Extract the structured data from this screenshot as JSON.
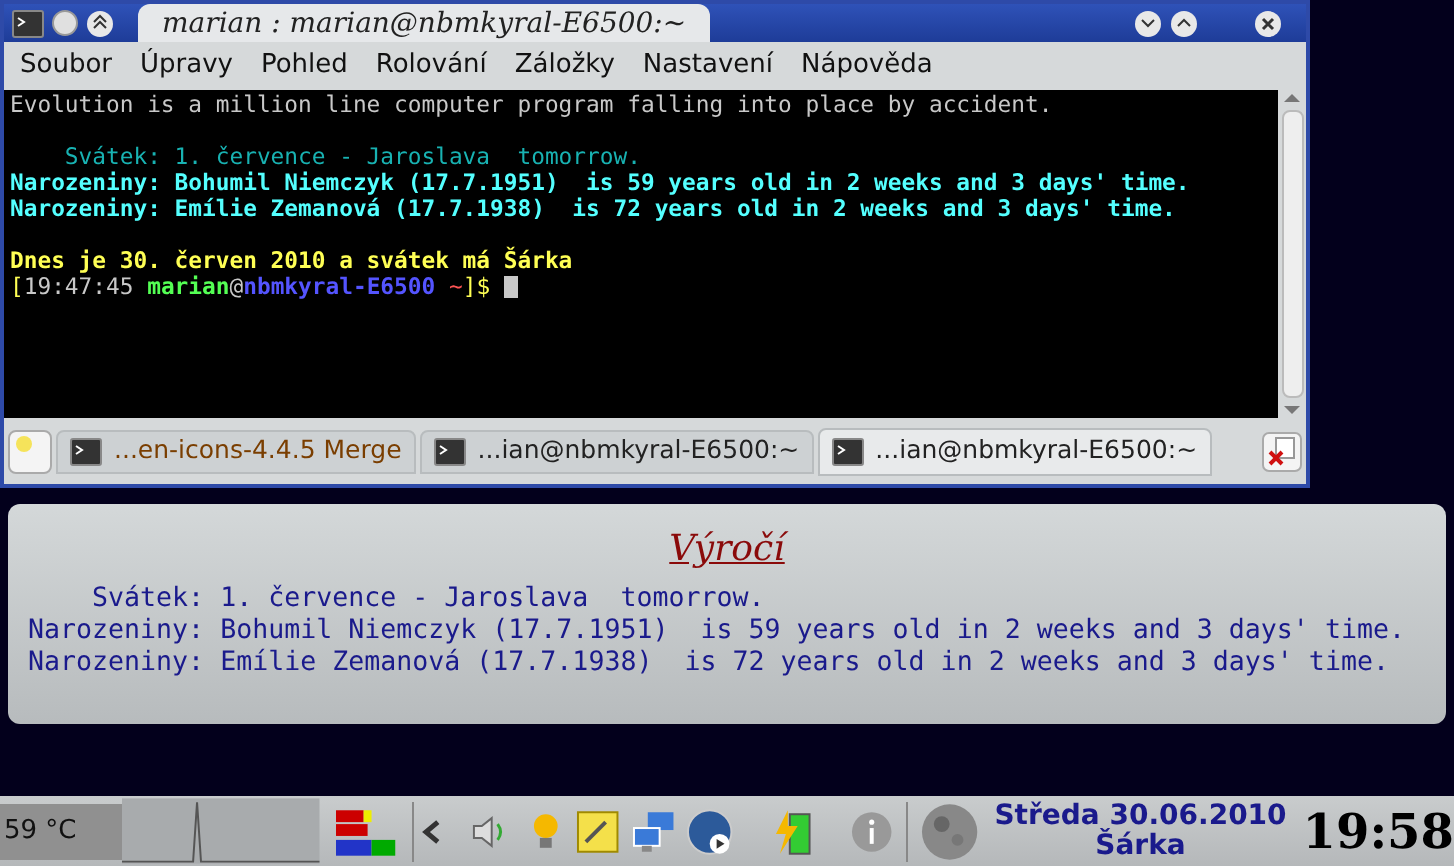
{
  "window": {
    "title": "marian : marian@nbmkyral-E6500:~"
  },
  "menu": [
    "Soubor",
    "Úpravy",
    "Pohled",
    "Rolování",
    "Záložky",
    "Nastavení",
    "Nápověda"
  ],
  "terminal": {
    "lines": [
      {
        "kind": "text",
        "segments": [
          {
            "text": "Evolution is a million line computer program falling into place by accident.",
            "color": "#c8c8c8",
            "bold": false
          }
        ]
      },
      {
        "kind": "blank"
      },
      {
        "kind": "text",
        "segments": [
          {
            "text": "    Svátek: 1. července - Jaroslava  tomorrow.",
            "color": "#18b2b2",
            "bold": false
          }
        ]
      },
      {
        "kind": "text",
        "segments": [
          {
            "text": "Narozeniny: Bohumil Niemczyk (17.7.1951)  is 59 years old in 2 weeks and 3 days' time.",
            "color": "#54ffff",
            "bold": true
          }
        ]
      },
      {
        "kind": "text",
        "segments": [
          {
            "text": "Narozeniny: Emílie Zemanová (17.7.1938)  is 72 years old in 2 weeks and 3 days' time.",
            "color": "#54ffff",
            "bold": true
          }
        ]
      },
      {
        "kind": "blank"
      },
      {
        "kind": "text",
        "segments": [
          {
            "text": "Dnes je 30. červen 2010 a svátek má Šárka",
            "color": "#ffff54",
            "bold": true
          }
        ]
      },
      {
        "kind": "text",
        "segments": [
          {
            "text": "[",
            "color": "#ffff54",
            "bold": false
          },
          {
            "text": "19:47:45 ",
            "color": "#c8c8c8",
            "bold": false
          },
          {
            "text": "marian",
            "color": "#54ff54",
            "bold": true
          },
          {
            "text": "@",
            "color": "#c8c8c8",
            "bold": false
          },
          {
            "text": "nbmkyral-E6500",
            "color": "#5454ff",
            "bold": true
          },
          {
            "text": " ~",
            "color": "#ff5454",
            "bold": false
          },
          {
            "text": "]$ ",
            "color": "#ffff54",
            "bold": false
          }
        ]
      }
    ]
  },
  "tabs": [
    {
      "label": "...en-icons-4.4.5 Merge",
      "selected": false,
      "activity": true
    },
    {
      "label": "...ian@nbmkyral-E6500:~",
      "selected": false,
      "activity": false
    },
    {
      "label": "...ian@nbmkyral-E6500:~",
      "selected": true,
      "activity": false
    }
  ],
  "popup": {
    "title": "Výročí",
    "lines": [
      "    Svátek: 1. července - Jaroslava  tomorrow.",
      "Narozeniny: Bohumil Niemczyk (17.7.1951)  is 59 years old in 2 weeks and 3 days' time.",
      "Narozeniny: Emílie Zemanová (17.7.1938)  is 72 years old in 2 weeks and 3 days' time."
    ]
  },
  "taskbar": {
    "temperature": "59 °C",
    "date": "Středa 30.06.2010",
    "nameday": "Šárka",
    "time": "19:58"
  }
}
